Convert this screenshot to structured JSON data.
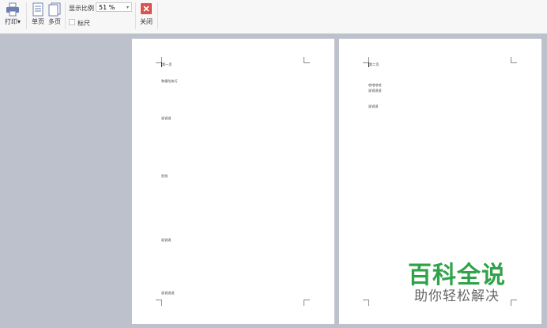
{
  "toolbar": {
    "print_label": "打印",
    "single_page_label": "单页",
    "multi_page_label": "多页",
    "zoom_label": "显示比例",
    "zoom_value": "51 %",
    "ruler_label": "标尺",
    "close_label": "关闭"
  },
  "pages": [
    {
      "lines": [
        "第一页",
        "和保险执行",
        "说说说",
        "别别",
        "说说说",
        "说说说说"
      ]
    },
    {
      "lines": [
        "第二页",
        "哈哈哈哈",
        "说说说说",
        "说说说"
      ]
    }
  ],
  "watermark": {
    "title": "百科全说",
    "subtitle": "助你轻松解决"
  },
  "colors": {
    "close_button": "#d9534f",
    "watermark_green": "#2fa34a",
    "workspace": "#bcc1cc"
  }
}
